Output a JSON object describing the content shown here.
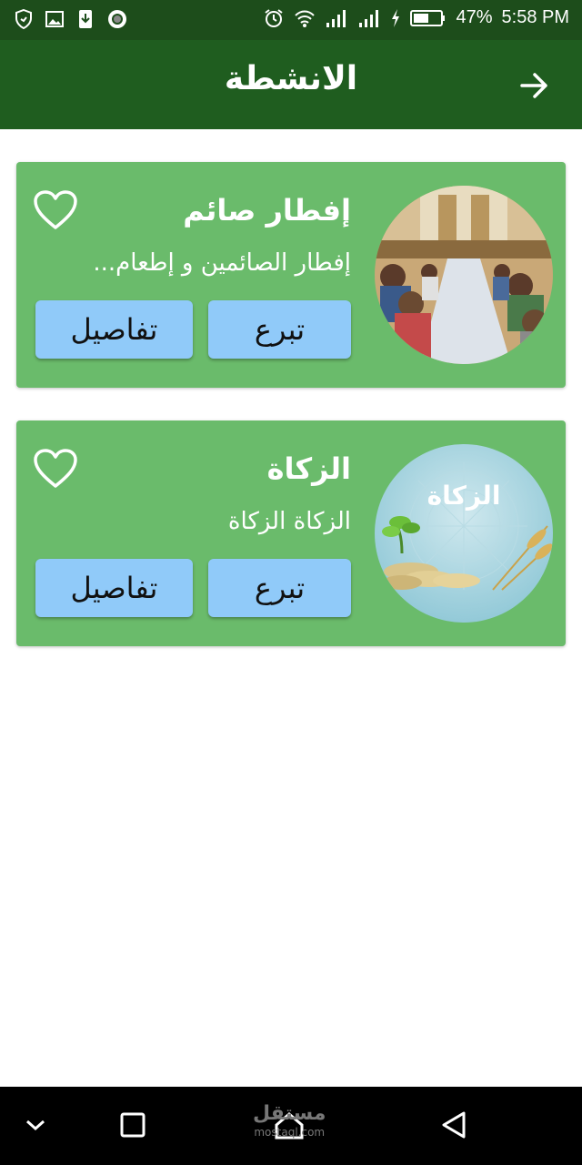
{
  "status_bar": {
    "battery": "47%",
    "time": "5:58 PM"
  },
  "header": {
    "title": "الانشطة",
    "back_icon": "arrow-right-icon"
  },
  "activities": [
    {
      "title": "إفطار صائم",
      "description": "إفطار الصائمين و إطعام...",
      "donate_label": "تبرع",
      "details_label": "تفاصيل",
      "favorite_icon": "heart-outline-icon"
    },
    {
      "title": "الزكاة",
      "description": "الزكاة الزكاة",
      "image_text": "الزكاة",
      "donate_label": "تبرع",
      "details_label": "تفاصيل",
      "favorite_icon": "heart-outline-icon"
    }
  ],
  "nav_bar": {
    "watermark": "مستقل",
    "watermark_sub": "mostaql.com"
  },
  "colors": {
    "status_bar": "#1d4d1b",
    "app_bar": "#1f5d1f",
    "card": "#6abb6b",
    "button": "#90caf9"
  }
}
